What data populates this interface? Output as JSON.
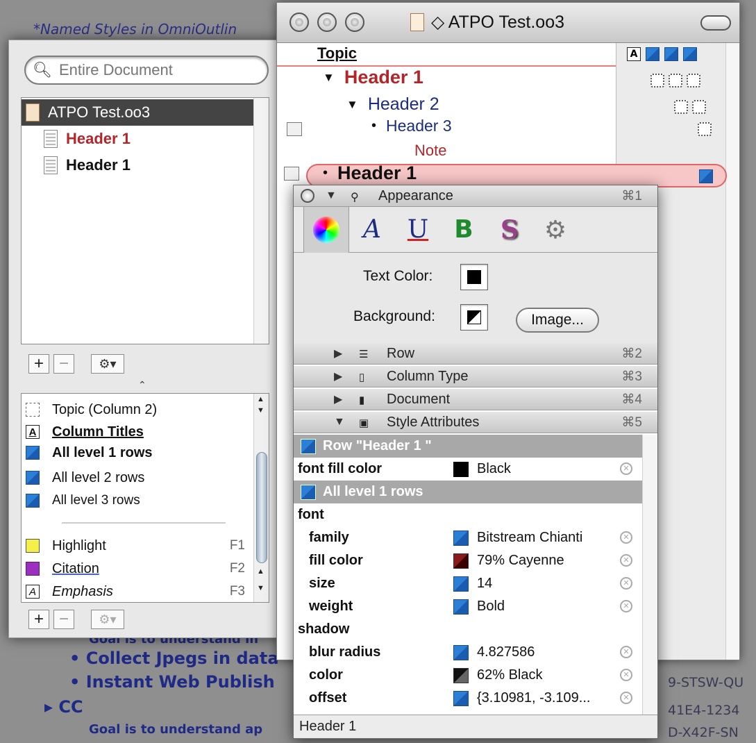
{
  "background": {
    "top_text": "*Named Styles in OmniOutlin",
    "bullets": [
      "Collect Jpegs in data",
      "Instant Web Publish"
    ],
    "section": "CC",
    "partial_above": "Goal is to understand in",
    "goal_text": "Goal is to understand ap",
    "right_text": [
      "9-STSW-QU",
      "41E4-1234",
      "D-X42F-SN"
    ]
  },
  "left_panel": {
    "search": {
      "placeholder": "Entire Document",
      "value": ""
    },
    "documents": [
      {
        "label": "ATPO Test.oo3",
        "selected": true
      },
      {
        "label": "Header 1",
        "color": "#b2262a"
      },
      {
        "label": "Header 1",
        "color": "#111111"
      }
    ],
    "add_label": "+",
    "remove_label": "−",
    "gear_label": "⚙▾",
    "splitter_label": "⌃",
    "styles": [
      {
        "label": "Topic (Column 2)",
        "icon": "dashed-box-icon"
      },
      {
        "label": "Column Titles",
        "icon": "letter-a-box-icon"
      },
      {
        "label": "All level 1 rows",
        "icon": "blue-style-icon"
      },
      {
        "label": "All level 2 rows",
        "icon": "blue-style-icon"
      },
      {
        "label": "All level 3 rows",
        "icon": "blue-style-icon"
      },
      {
        "label": "Highlight",
        "icon": "yellow-style-icon",
        "key": "F1"
      },
      {
        "label": "Citation",
        "icon": "purple-style-icon",
        "key": "F2"
      },
      {
        "label": "Emphasis",
        "icon": "italic-a-box-icon",
        "key": "F3"
      }
    ]
  },
  "document_window": {
    "title": "◇ ATPO Test.oo3",
    "topic_column": "Topic",
    "rows": [
      {
        "label": "Header 1",
        "level": 1
      },
      {
        "label": "Header 2",
        "level": 2
      },
      {
        "label": "Header 3",
        "level": 3
      },
      {
        "label": "Note",
        "kind": "note"
      },
      {
        "label": "Header 1",
        "level": 1,
        "selected": true
      }
    ]
  },
  "inspector": {
    "sections": [
      {
        "label": "Appearance",
        "key": "⌘1",
        "expanded": true
      },
      {
        "label": "Row",
        "key": "⌘2"
      },
      {
        "label": "Column Type",
        "key": "⌘3"
      },
      {
        "label": "Document",
        "key": "⌘4"
      },
      {
        "label": "Style Attributes",
        "key": "⌘5",
        "expanded": true
      }
    ],
    "tabs": [
      "color-wheel-icon",
      "font-icon",
      "underline-icon",
      "bold-icon",
      "shadow-icon",
      "gear-icon"
    ],
    "tab_glyphs": {
      "font": "A",
      "underline": "U",
      "bold": "B",
      "shadow": "S",
      "gear": "⚙"
    },
    "text_color_label": "Text Color:",
    "background_label": "Background:",
    "image_button": "Image...",
    "attributes": {
      "group1": "Row \"Header 1 \"",
      "font_fill_color": {
        "name": "font fill color",
        "value": "Black"
      },
      "group2": "All level 1 rows",
      "font_label": "font",
      "family": {
        "name": "family",
        "value": "Bitstream Chianti"
      },
      "fill_color": {
        "name": "fill color",
        "value": "79% Cayenne"
      },
      "size": {
        "name": "size",
        "value": "14"
      },
      "weight": {
        "name": "weight",
        "value": "Bold"
      },
      "shadow_label": "shadow",
      "blur_radius": {
        "name": "blur radius",
        "value": "4.827586"
      },
      "color": {
        "name": "color",
        "value": "62% Black"
      },
      "offset": {
        "name": "offset",
        "value": "{3.10981, -3.109..."
      }
    },
    "status": "Header 1"
  }
}
